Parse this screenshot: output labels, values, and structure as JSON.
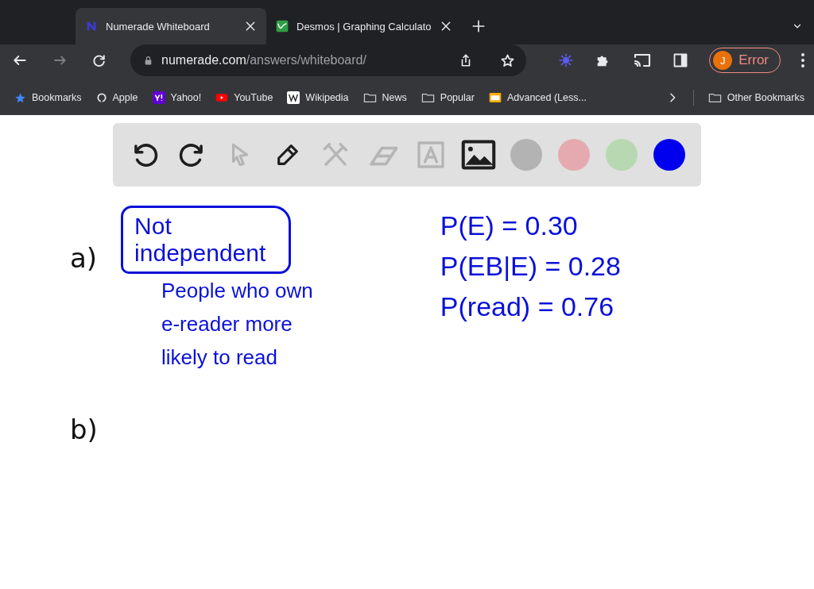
{
  "tabs": [
    {
      "title": "Numerade Whiteboard",
      "selected": true,
      "kind": "numerade"
    },
    {
      "title": "Desmos | Graphing Calculato",
      "selected": false,
      "kind": "desmos"
    }
  ],
  "address": {
    "host": "numerade.com",
    "path": "/answers/whiteboard/"
  },
  "profile": {
    "initial": "J",
    "label": "Error"
  },
  "bookmarks": [
    {
      "label": "Bookmarks",
      "kind": "star"
    },
    {
      "label": "Apple",
      "kind": "apple"
    },
    {
      "label": "Yahoo!",
      "kind": "yahoo"
    },
    {
      "label": "YouTube",
      "kind": "youtube"
    },
    {
      "label": "Wikipedia",
      "kind": "wiki"
    },
    {
      "label": "News",
      "kind": "folder"
    },
    {
      "label": "Popular",
      "kind": "folder"
    },
    {
      "label": "Advanced (Less...",
      "kind": "note"
    }
  ],
  "other_bookmarks": "Other Bookmarks",
  "tools": [
    {
      "kind": "undo",
      "disabled": false
    },
    {
      "kind": "redo",
      "disabled": false
    },
    {
      "kind": "pointer",
      "disabled": true
    },
    {
      "kind": "pen",
      "disabled": false
    },
    {
      "kind": "tools",
      "disabled": true
    },
    {
      "kind": "eraser",
      "disabled": true
    },
    {
      "kind": "text",
      "disabled": true
    },
    {
      "kind": "image",
      "disabled": false
    }
  ],
  "swatches": [
    {
      "color": "#b3b3b3"
    },
    {
      "color": "#e4aab0"
    },
    {
      "color": "#b8d8b2"
    },
    {
      "color": "#0000ee"
    }
  ],
  "notes": {
    "part_a": {
      "label": "a)",
      "color": "#111111",
      "boxed": {
        "text": "Not independent",
        "color": "#0a10d8"
      },
      "lines": [
        {
          "text": "People who own",
          "color": "#0a10d8"
        },
        {
          "text": "e-reader more",
          "color": "#0a10d8"
        },
        {
          "text": "likely to read",
          "color": "#0a10d8"
        }
      ]
    },
    "part_b": {
      "label": "b)",
      "color": "#111111"
    },
    "equations": [
      {
        "text": "P(E) = 0.30",
        "color": "#0a10d8"
      },
      {
        "text": "P(EB|E) = 0.28",
        "color": "#0a10d8"
      },
      {
        "text": "P(read) = 0.76",
        "color": "#0a10d8"
      }
    ]
  }
}
